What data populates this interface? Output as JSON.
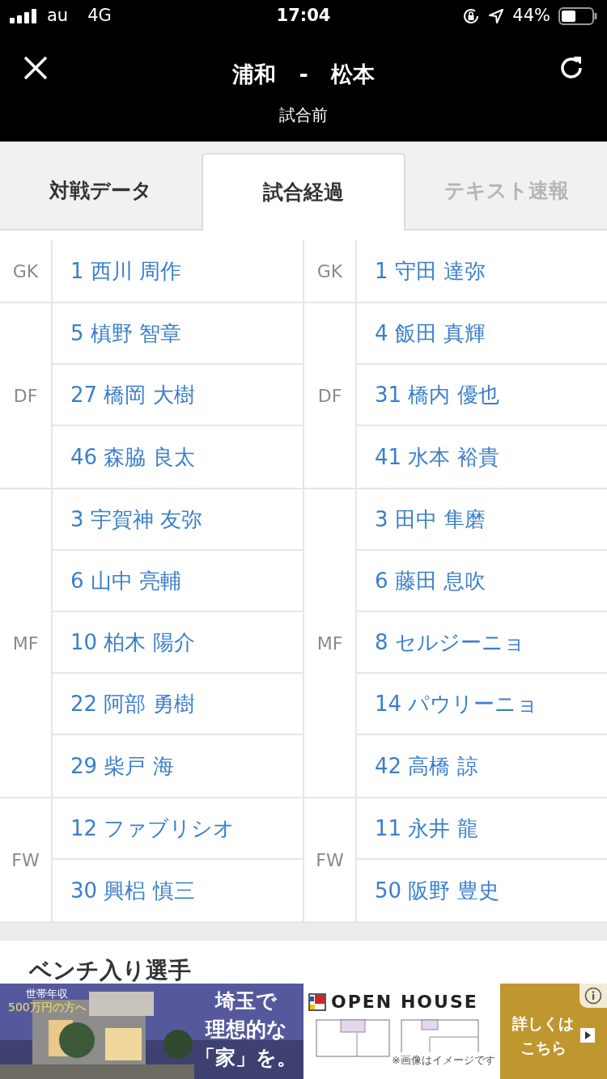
{
  "status_bar": {
    "carrier": "au",
    "network": "4G",
    "time": "17:04",
    "battery": "44%"
  },
  "header": {
    "title_home": "浦和",
    "separator": "-",
    "title_away": "松本",
    "status": "試合前"
  },
  "tabs": [
    {
      "label": "対戦データ",
      "selected": false,
      "disabled": false
    },
    {
      "label": "試合経過",
      "selected": true,
      "disabled": false
    },
    {
      "label": "テキスト速報",
      "selected": false,
      "disabled": true
    }
  ],
  "lineups": [
    {
      "groups": [
        {
          "position": "GK",
          "players": [
            "1 西川 周作"
          ]
        },
        {
          "position": "DF",
          "players": [
            "5 槙野 智章",
            "27 橋岡 大樹",
            "46 森脇 良太"
          ]
        },
        {
          "position": "MF",
          "players": [
            "3 宇賀神 友弥",
            "6 山中 亮輔",
            "10 柏木 陽介",
            "22 阿部 勇樹",
            "29 柴戸 海"
          ]
        },
        {
          "position": "FW",
          "players": [
            "12 ファブリシオ",
            "30 興梠 慎三"
          ]
        }
      ]
    },
    {
      "groups": [
        {
          "position": "GK",
          "players": [
            "1 守田 達弥"
          ]
        },
        {
          "position": "DF",
          "players": [
            "4 飯田 真輝",
            "31 橋内 優也",
            "41 水本 裕貴"
          ]
        },
        {
          "position": "MF",
          "players": [
            "3 田中 隼磨",
            "6 藤田 息吹",
            "8 セルジーニョ",
            "14 パウリーニョ",
            "42 高橋 諒"
          ]
        },
        {
          "position": "FW",
          "players": [
            "11 永井 龍",
            "50 阪野 豊史"
          ]
        }
      ]
    }
  ],
  "bench_heading": "ベンチ入り選手",
  "ad": {
    "badge_line1": "世帯年収",
    "badge_line2": "500万円の方へ",
    "headline": [
      "埼玉で",
      "理想的な",
      "「家」を。"
    ],
    "brand": "OPEN HOUSE",
    "note": "※画像はイメージです",
    "cta": [
      "詳しくは",
      "こちら"
    ]
  }
}
